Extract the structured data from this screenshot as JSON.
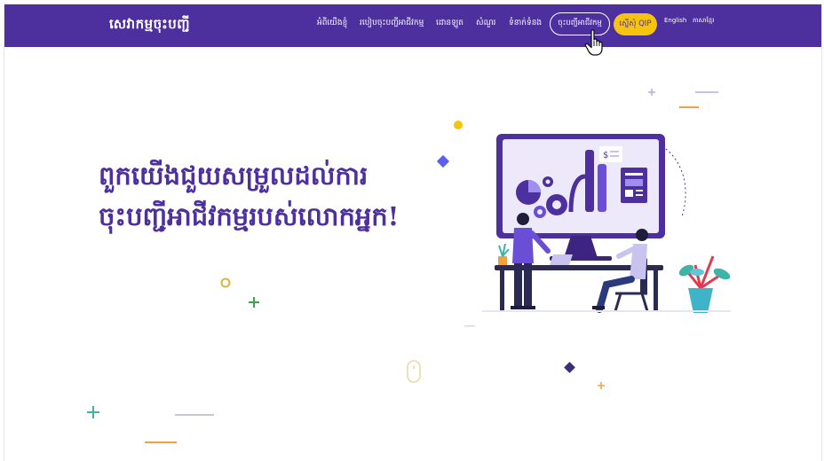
{
  "navbar": {
    "brand": "សេវាកម្មចុះបញ្ជី",
    "links": [
      {
        "label": "អំពីយើងខ្ញុំ"
      },
      {
        "label": "របៀបចុះបញ្ជីអាជីវកម្ម"
      },
      {
        "label": "ដោនឡូត"
      },
      {
        "label": "សំណួរ"
      },
      {
        "label": "ទំនាក់ទំនង"
      }
    ],
    "register_button": "ចុះបញ្ជីអាជីវកម្ម",
    "qip_button": "ស្នើសុំ QIP",
    "lang_en": "English",
    "lang_km": "ភាសាខ្មែរ"
  },
  "hero": {
    "line1": "ពួកយើងជួយសម្រួលដល់ការ",
    "line2": "ចុះបញ្ជីអាជីវកម្មរបស់លោកអ្នក!"
  },
  "icons": {
    "cursor": "hand-pointer-icon",
    "mouse": "mouse-scroll-icon"
  },
  "colors": {
    "primary": "#4d2f9e",
    "accent": "#f6c40e",
    "background": "#ffffff"
  }
}
